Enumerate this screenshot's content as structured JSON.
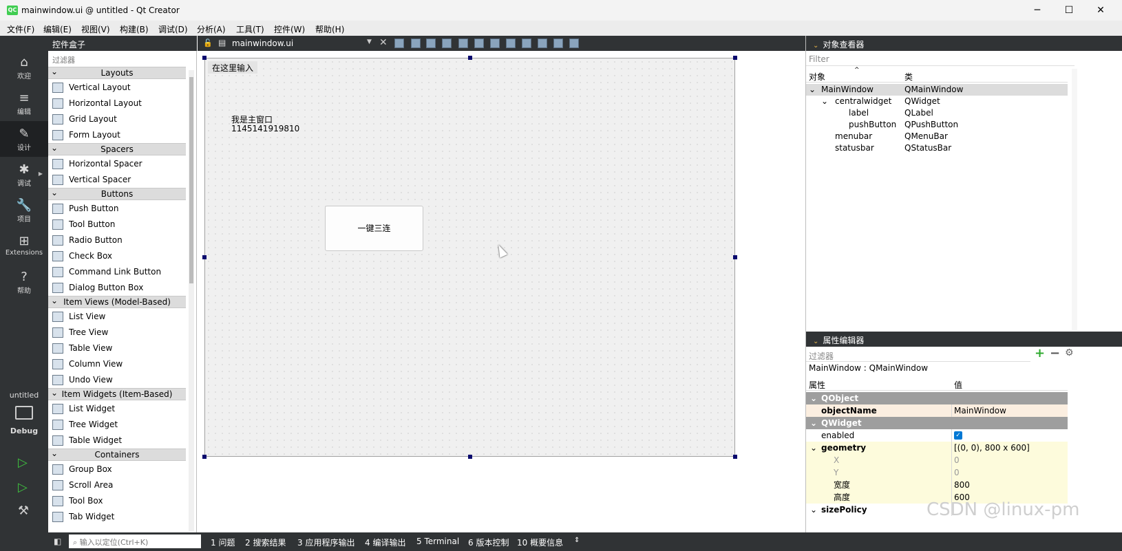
{
  "window": {
    "title": "mainwindow.ui @ untitled - Qt Creator",
    "logo": "QC",
    "minimize": "─",
    "maximize": "☐",
    "close": "✕"
  },
  "menu": [
    "文件(F)",
    "编辑(E)",
    "视图(V)",
    "构建(B)",
    "调试(D)",
    "分析(A)",
    "工具(T)",
    "控件(W)",
    "帮助(H)"
  ],
  "modes": [
    {
      "label": "欢迎",
      "icon": "home-icon",
      "glyph": "⌂"
    },
    {
      "label": "编辑",
      "icon": "edit-icon",
      "glyph": "≡"
    },
    {
      "label": "设计",
      "icon": "design-icon",
      "glyph": "✎"
    },
    {
      "label": "调试",
      "icon": "debug-icon",
      "glyph": "✱"
    },
    {
      "label": "项目",
      "icon": "wrench-icon",
      "glyph": "🔧"
    },
    {
      "label": "Extensions",
      "icon": "extensions-icon",
      "glyph": "⊞"
    },
    {
      "label": "帮助",
      "icon": "help-icon",
      "glyph": "?"
    }
  ],
  "kit": {
    "project": "untitled",
    "config": "Debug"
  },
  "widgetbox": {
    "title": "控件盒子",
    "filter_placeholder": "过滤器",
    "categories": [
      {
        "name": "Layouts",
        "items": [
          "Vertical Layout",
          "Horizontal Layout",
          "Grid Layout",
          "Form Layout"
        ]
      },
      {
        "name": "Spacers",
        "items": [
          "Horizontal Spacer",
          "Vertical Spacer"
        ]
      },
      {
        "name": "Buttons",
        "items": [
          "Push Button",
          "Tool Button",
          "Radio Button",
          "Check Box",
          "Command Link Button",
          "Dialog Button Box"
        ]
      },
      {
        "name": "Item Views (Model-Based)",
        "items": [
          "List View",
          "Tree View",
          "Table View",
          "Column View",
          "Undo View"
        ]
      },
      {
        "name": "Item Widgets (Item-Based)",
        "items": [
          "List Widget",
          "Tree Widget",
          "Table Widget"
        ]
      },
      {
        "name": "Containers",
        "items": [
          "Group Box",
          "Scroll Area",
          "Tool Box",
          "Tab Widget"
        ]
      }
    ]
  },
  "editor": {
    "file": "mainwindow.ui",
    "menu_placeholder": "在这里输入",
    "label_line1": "我是主窗口",
    "label_line2": "1145141919810",
    "button_text": "一键三连"
  },
  "object_inspector": {
    "title": "对象查看器",
    "filter_placeholder": "Filter",
    "col_object": "对象",
    "col_class": "类",
    "rows": [
      {
        "name": "MainWindow",
        "cls": "QMainWindow",
        "indent": 0,
        "expander": "⌄"
      },
      {
        "name": "centralwidget",
        "cls": "QWidget",
        "indent": 1,
        "expander": "⌄"
      },
      {
        "name": "label",
        "cls": "QLabel",
        "indent": 2,
        "expander": ""
      },
      {
        "name": "pushButton",
        "cls": "QPushButton",
        "indent": 2,
        "expander": ""
      },
      {
        "name": "menubar",
        "cls": "QMenuBar",
        "indent": 1,
        "expander": ""
      },
      {
        "name": "statusbar",
        "cls": "QStatusBar",
        "indent": 1,
        "expander": ""
      }
    ]
  },
  "property_editor": {
    "title": "属性编辑器",
    "filter_placeholder": "过滤器",
    "subtitle": "MainWindow : QMainWindow",
    "col_prop": "属性",
    "col_value": "值",
    "rows": [
      {
        "prop": "QObject",
        "value": "",
        "kind": "group"
      },
      {
        "prop": "objectName",
        "value": "MainWindow",
        "kind": "hl"
      },
      {
        "prop": "QWidget",
        "value": "",
        "kind": "group"
      },
      {
        "prop": "enabled",
        "value": "✓",
        "kind": "check"
      },
      {
        "prop": "geometry",
        "value": "[(0, 0), 800 x 600]",
        "kind": "yelbold"
      },
      {
        "prop": "X",
        "value": "0",
        "kind": "sub"
      },
      {
        "prop": "Y",
        "value": "0",
        "kind": "sub"
      },
      {
        "prop": "宽度",
        "value": "800",
        "kind": "subdark"
      },
      {
        "prop": "高度",
        "value": "600",
        "kind": "subdark"
      },
      {
        "prop": "sizePolicy",
        "value": "",
        "kind": "bold"
      }
    ]
  },
  "statusbar": {
    "search_placeholder": "输入以定位(Ctrl+K)",
    "tabs": [
      "1  问题",
      "2  搜索结果",
      "3  应用程序输出",
      "4  编译输出",
      "5  Terminal",
      "6  版本控制",
      "10  概要信息"
    ]
  },
  "watermark": "CSDN @linux-pm"
}
